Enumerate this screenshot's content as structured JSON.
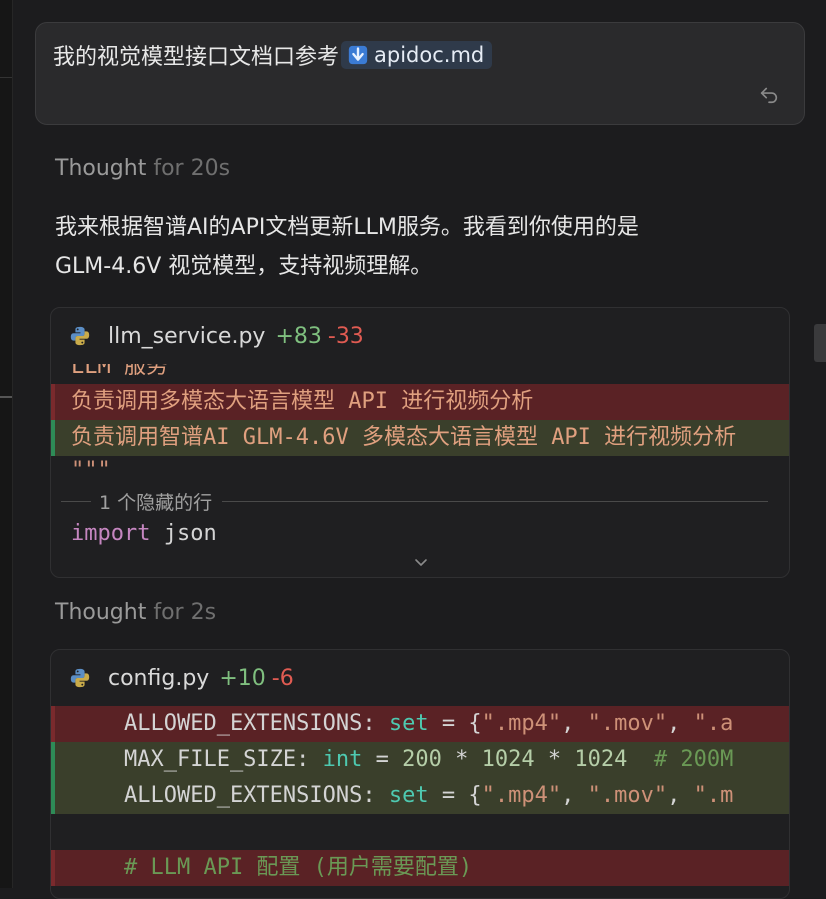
{
  "prompt": {
    "text": "我的视觉模型接口文档口参考",
    "attachment": "apidoc.md",
    "attachment_icon": "download-arrow-icon",
    "action_icon": "undo-icon"
  },
  "thought1": {
    "label": "Thought",
    "duration": "for 20s"
  },
  "message": {
    "line1": "我来根据智谱AI的API文档更新LLM服务。我看到你使用的是",
    "line2": "GLM-4.6V 视觉模型，支持视频理解。"
  },
  "card1": {
    "filename": "llm_service.py",
    "added": "+83",
    "removed": "-33",
    "lines": {
      "partial": "LLM 服务",
      "removed": "负责调用多模态大语言模型 API 进行视频分析",
      "added": "负责调用智谱AI GLM-4.6V 多模态大语言模型 API 进行视频分析",
      "quotes": "\"\"\""
    },
    "hidden": "1 个隐藏的行",
    "import_kw": "import",
    "import_mod": "json"
  },
  "thought2": {
    "label": "Thought",
    "duration": "for 2s"
  },
  "card2": {
    "filename": "config.py",
    "added": "+10",
    "removed": "-6",
    "comment_line": "# LLM API 配置 (用户需要配置)"
  },
  "colors": {
    "added": "#7fbf7f",
    "removed": "#e05b52",
    "chip": "#2f3a4a"
  }
}
